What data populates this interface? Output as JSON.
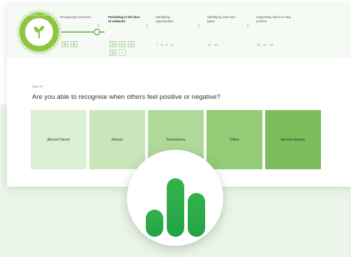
{
  "colors": {
    "brand": "#8cc63f",
    "accent": "#2fa84f",
    "background_band": "#eaf4e8"
  },
  "logo": {
    "ring_text": "SPRING TOOLS"
  },
  "steps": [
    {
      "label": "Recognising emotions",
      "pills": [
        "4",
        "5"
      ]
    },
    {
      "label": "Persisting in the face of setbacks",
      "pills": [
        "1",
        "2",
        "3",
        "4",
        "5"
      ]
    },
    {
      "label": "Identifying opportunities",
      "nums": "7 8 9 10"
    },
    {
      "label": "Identifying risks and gains",
      "nums": "11 12"
    },
    {
      "label": "Supporting others to stay positive",
      "nums": "13 14 15"
    }
  ],
  "item": {
    "label": "Item 4 /"
  },
  "question": "Are you able to recognise when others feel positive or negative?",
  "answers": [
    "Almost Never",
    "Rarely",
    "Sometimes",
    "Often",
    "Almost Always"
  ],
  "app_icon": {
    "name": "bar-chart-icon",
    "levels": [
      0.44,
      0.95,
      0.72
    ]
  }
}
